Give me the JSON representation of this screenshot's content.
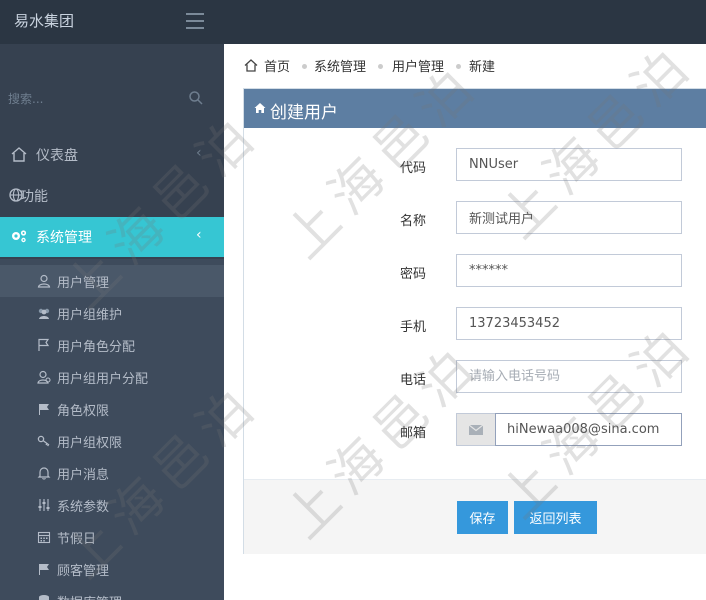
{
  "app": {
    "brand": "易水集团"
  },
  "search": {
    "placeholder": "搜索..."
  },
  "sidebar": {
    "dashboard": "仪表盘",
    "functions": "功能",
    "system": "系统管理",
    "submenu": [
      {
        "label": "用户管理",
        "icon": "user-icon"
      },
      {
        "label": "用户组维护",
        "icon": "users-icon"
      },
      {
        "label": "用户角色分配",
        "icon": "flag-icon"
      },
      {
        "label": "用户组用户分配",
        "icon": "user-group-icon"
      },
      {
        "label": "角色权限",
        "icon": "flag-filled-icon"
      },
      {
        "label": "用户组权限",
        "icon": "key-icon"
      },
      {
        "label": "用户消息",
        "icon": "bell-icon"
      },
      {
        "label": "系统参数",
        "icon": "sliders-icon"
      },
      {
        "label": "节假日",
        "icon": "calendar-icon"
      },
      {
        "label": "顾客管理",
        "icon": "flag-filled-icon"
      },
      {
        "label": "数据库管理",
        "icon": "database-icon"
      }
    ]
  },
  "breadcrumb": {
    "home": "首页",
    "system": "系统管理",
    "users": "用户管理",
    "current": "新建"
  },
  "panel": {
    "title": "创建用户"
  },
  "form": {
    "code": {
      "label": "代码",
      "value": "NNUser"
    },
    "name": {
      "label": "名称",
      "value": "新测试用户"
    },
    "password": {
      "label": "密码",
      "value": "******"
    },
    "mobile": {
      "label": "手机",
      "value": "13723453452"
    },
    "phone": {
      "label": "电话",
      "placeholder": "请输入电话号码"
    },
    "email": {
      "label": "邮箱",
      "value": "hiNewaa008@sina.com"
    }
  },
  "actions": {
    "save": "保存",
    "back": "返回列表"
  },
  "watermark": "上海邑泊",
  "colors": {
    "topbar": "#2b3643",
    "sidebar": "#364150",
    "active": "#36c6d3",
    "panel_head": "#5d7ea2",
    "button": "#3598dc"
  }
}
